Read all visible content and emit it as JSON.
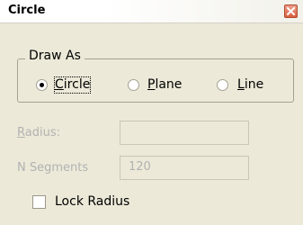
{
  "window": {
    "title": "Circle",
    "close_icon": "close-icon"
  },
  "draw_as": {
    "label": "Draw As",
    "options": [
      {
        "label": "Circle",
        "selected": true
      },
      {
        "label": "Plane",
        "selected": false
      },
      {
        "label": "Line",
        "selected": false
      }
    ]
  },
  "radius": {
    "label": "Radius:",
    "value": ""
  },
  "n_segments": {
    "label": "N Segments",
    "value": "120"
  },
  "lock_radius": {
    "label": "Lock Radius",
    "checked": false
  }
}
